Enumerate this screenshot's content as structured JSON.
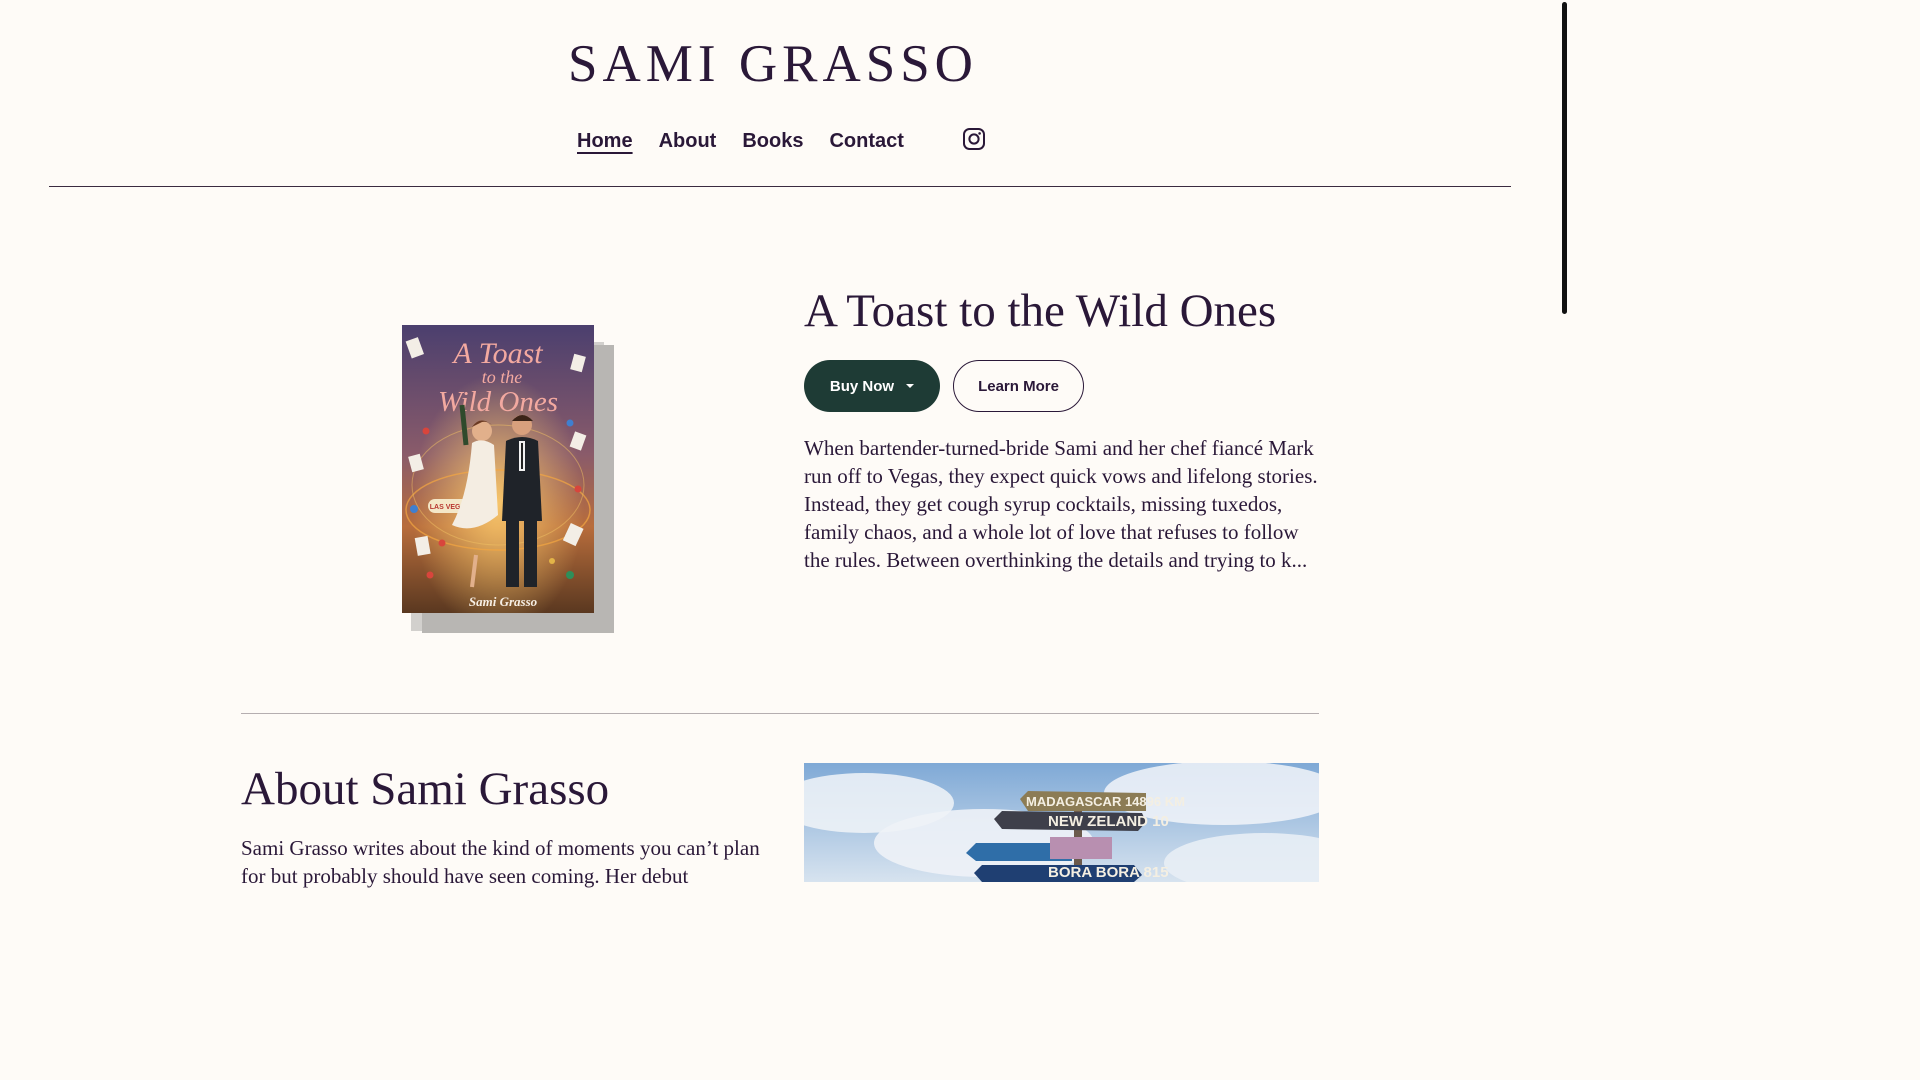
{
  "site": {
    "title": "SAMI GRASSO"
  },
  "nav": {
    "items": [
      "Home",
      "About",
      "Books",
      "Contact"
    ],
    "active": "Home",
    "social_icon": "instagram-icon"
  },
  "featured_book": {
    "title": "A Toast to the Wild Ones",
    "buy_label": "Buy Now",
    "learn_label": "Learn More",
    "description": "When bartender-turned-bride Sami and her chef fiancé Mark run off to Vegas, they expect quick vows and lifelong stories. Instead, they get cough syrup cocktails, missing tuxedos, family chaos, and a whole lot of love that refuses to follow the rules. Between overthinking the details and trying to k...",
    "cover": {
      "title_line1": "A Toast",
      "title_line2": "to the",
      "title_line3": "Wild Ones",
      "sign_text": "LAS VEGAS",
      "author": "Sami Grasso"
    }
  },
  "about": {
    "title": "About Sami Grasso",
    "text": "Sami Grasso writes about the kind of moments you can’t plan for but probably should have seen coming. Her debut",
    "signpost": [
      "MADAGASCAR 14896 KM",
      "NEW ZELAND 10",
      "BORA BORA 815"
    ]
  },
  "colors": {
    "background": "#fefbf7",
    "text": "#2a1838",
    "buy_button": "#1e3b35"
  }
}
